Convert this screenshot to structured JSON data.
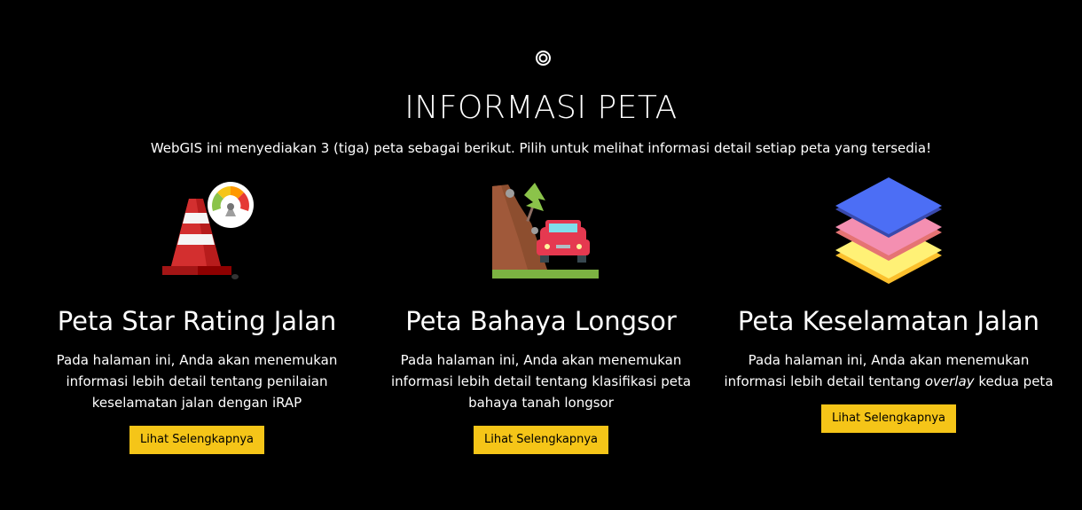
{
  "section": {
    "icon": "ring-icon",
    "title": "INFORMASI PETA",
    "description": "WebGIS ini menyediakan 3 (tiga) peta sebagai berikut. Pilih untuk melihat informasi detail setiap peta yang tersedia!"
  },
  "cards": [
    {
      "icon": "traffic-cone-gauge-icon",
      "title": "Peta Star Rating Jalan",
      "description": "Pada halaman ini, Anda akan menemukan informasi lebih detail tentang penilaian keselamatan jalan dengan iRAP",
      "button_label": "Lihat Selengkapnya"
    },
    {
      "icon": "landslide-car-icon",
      "title": "Peta Bahaya Longsor",
      "description": "Pada halaman ini, Anda akan menemukan informasi lebih detail tentang klasifikasi peta bahaya tanah longsor",
      "button_label": "Lihat Selengkapnya"
    },
    {
      "icon": "map-layers-icon",
      "title": "Peta Keselamatan Jalan",
      "description_before": "Pada halaman ini, Anda akan menemukan informasi lebih detail tentang ",
      "description_emphasis": "overlay",
      "description_after": " kedua peta",
      "button_label": "Lihat Selengkapnya"
    }
  ],
  "colors": {
    "background": "#000000",
    "text": "#ffffff",
    "button": "#f5c518"
  }
}
